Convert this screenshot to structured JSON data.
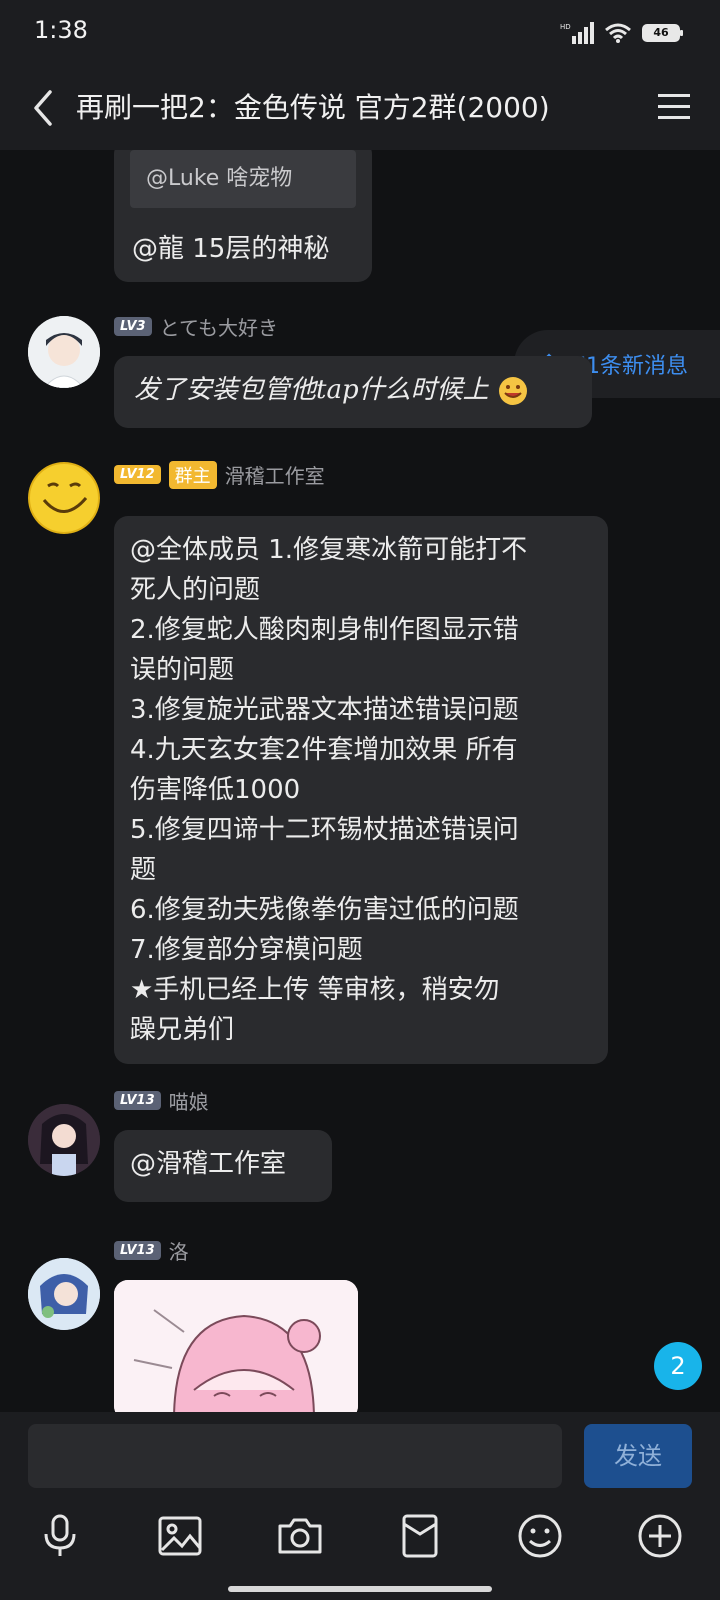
{
  "status_bar": {
    "time": "1:38",
    "network": "HD",
    "battery": "46"
  },
  "header": {
    "title": "再刷一把2：金色传说 官方2群(2000)"
  },
  "chat": {
    "quoted_reply": {
      "quote": "@Luke 啥宠物",
      "text": "@龍 15层的神秘"
    },
    "new_messages": "71条新消息",
    "messages": [
      {
        "level": "LV3",
        "name": "とても大好き",
        "text": "发了安装包管他tap什么时候上"
      },
      {
        "level": "LV12",
        "role": "群主",
        "name": "滑稽工作室",
        "lines": [
          "@全体成员 1.修复寒冰箭可能打不",
          "死人的问题",
          "2.修复蛇人酸肉刺身制作图显示错",
          "误的问题",
          "3.修复旋光武器文本描述错误问题",
          "4.九天玄女套2件套增加效果 所有",
          "伤害降低1000",
          "5.修复四谛十二环锡杖描述错误问",
          "题",
          "6.修复劲夫残像拳伤害过低的问题",
          "7.修复部分穿模问题",
          "★手机已经上传 等审核，稍安勿",
          "躁兄弟们"
        ]
      },
      {
        "level": "LV13",
        "name": "喵娘",
        "text": "@滑稽工作室"
      },
      {
        "level": "LV13",
        "name": "洛"
      }
    ],
    "unread_badge": "2"
  },
  "composer": {
    "input_value": "",
    "send_label": "发送"
  }
}
